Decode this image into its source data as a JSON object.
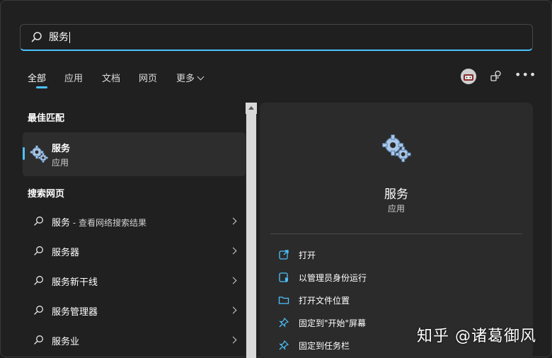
{
  "search": {
    "value": "服务"
  },
  "tabs": [
    {
      "label": "全部",
      "active": true
    },
    {
      "label": "应用"
    },
    {
      "label": "文档"
    },
    {
      "label": "网页"
    },
    {
      "label": "更多"
    }
  ],
  "best_match": {
    "heading": "最佳匹配",
    "title": "服务",
    "subtitle": "应用"
  },
  "web": {
    "heading": "搜索网页",
    "items": [
      {
        "label": "服务",
        "suffix": " - 查看网络搜索结果"
      },
      {
        "label": "服务器",
        "suffix": ""
      },
      {
        "label": "服务新干线",
        "suffix": ""
      },
      {
        "label": "服务管理器",
        "suffix": ""
      },
      {
        "label": "服务业",
        "suffix": ""
      }
    ]
  },
  "detail": {
    "title": "服务",
    "subtitle": "应用",
    "actions": [
      {
        "label": "打开",
        "icon": "open-icon"
      },
      {
        "label": "以管理员身份运行",
        "icon": "run-as-admin-icon"
      },
      {
        "label": "打开文件位置",
        "icon": "folder-icon"
      },
      {
        "label": "固定到\"开始\"屏幕",
        "icon": "pin-icon"
      },
      {
        "label": "固定到任务栏",
        "icon": "pin-icon"
      }
    ]
  },
  "watermark": "知乎 @诸葛御风",
  "colors": {
    "accent": "#4cc2ff",
    "panel": "#202020",
    "card": "#2b2b2b"
  }
}
